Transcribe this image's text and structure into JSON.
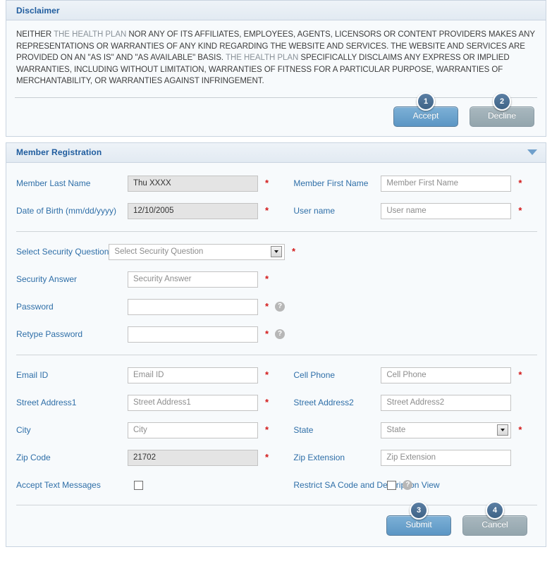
{
  "disclaimer_panel": {
    "title": "Disclaimer",
    "body_part1": "NEITHER ",
    "body_token1": "THE HEALTH PLAN",
    "body_part2": " NOR ANY OF ITS AFFILIATES, EMPLOYEES, AGENTS, LICENSORS OR CONTENT PROVIDERS MAKES ANY REPRESENTATIONS OR WARRANTIES OF ANY KIND REGARDING THE WEBSITE AND SERVICES. THE WEBSITE AND SERVICES ARE PROVIDED ON AN \"AS IS\" AND \"AS AVAILABLE\" BASIS. ",
    "body_token2": "THE HEALTH PLAN",
    "body_part3": "  SPECIFICALLY DISCLAIMS ANY EXPRESS OR IMPLIED WARRANTIES, INCLUDING WITHOUT LIMITATION, WARRANTIES OF FITNESS FOR A PARTICULAR PURPOSE, WARRANTIES OF MERCHANTABILITY, OR WARRANTIES AGAINST INFRINGEMENT.",
    "accept_label": "Accept",
    "accept_badge": "1",
    "decline_label": "Decline",
    "decline_badge": "2"
  },
  "registration_panel": {
    "title": "Member Registration",
    "collapse_icon": "chevron-down-icon",
    "fields": {
      "member_last_name": {
        "label": "Member Last Name",
        "value": "Thu XXXX",
        "required": "*"
      },
      "member_first_name": {
        "label": "Member First Name",
        "placeholder": "Member First Name",
        "required": "*"
      },
      "date_of_birth": {
        "label": "Date of Birth (mm/dd/yyyy)",
        "value": "12/10/2005",
        "required": "*"
      },
      "user_name": {
        "label": "User name",
        "placeholder": "User name",
        "required": "*"
      },
      "security_question": {
        "label": "Select Security Question",
        "selected": "Select Security Question",
        "required": "*"
      },
      "security_answer": {
        "label": "Security Answer",
        "placeholder": "Security Answer",
        "required": "*"
      },
      "password": {
        "label": "Password",
        "value": "",
        "required": "*",
        "help": "?"
      },
      "retype_password": {
        "label": "Retype Password",
        "value": "",
        "required": "*",
        "help": "?"
      },
      "email_id": {
        "label": "Email ID",
        "placeholder": "Email ID",
        "required": "*"
      },
      "cell_phone": {
        "label": "Cell Phone",
        "placeholder": "Cell Phone",
        "required": "*"
      },
      "street_address1": {
        "label": "Street Address1",
        "placeholder": "Street Address1",
        "required": "*"
      },
      "street_address2": {
        "label": "Street Address2",
        "placeholder": "Street Address2"
      },
      "city": {
        "label": "City",
        "placeholder": "City",
        "required": "*"
      },
      "state": {
        "label": "State",
        "selected": "State",
        "required": "*"
      },
      "zip_code": {
        "label": "Zip Code",
        "value": "21702",
        "required": "*"
      },
      "zip_extension": {
        "label": "Zip Extension",
        "placeholder": "Zip Extension"
      },
      "accept_text_messages": {
        "label": "Accept Text Messages",
        "checked": false
      },
      "restrict_sa_code": {
        "label": "Restrict SA Code and Description View",
        "checked": false,
        "help": "?"
      }
    },
    "submit_label": "Submit",
    "submit_badge": "3",
    "cancel_label": "Cancel",
    "cancel_badge": "4"
  },
  "colors": {
    "label_blue": "#2f6fa8",
    "title_blue": "#1f5c9e",
    "required_red": "#d31919",
    "primary_button": "#5b96c4",
    "secondary_button": "#93a5ad",
    "badge": "#3f6386",
    "panel_bg": "#f7fafc",
    "disabled_field": "#e4e4e4"
  }
}
